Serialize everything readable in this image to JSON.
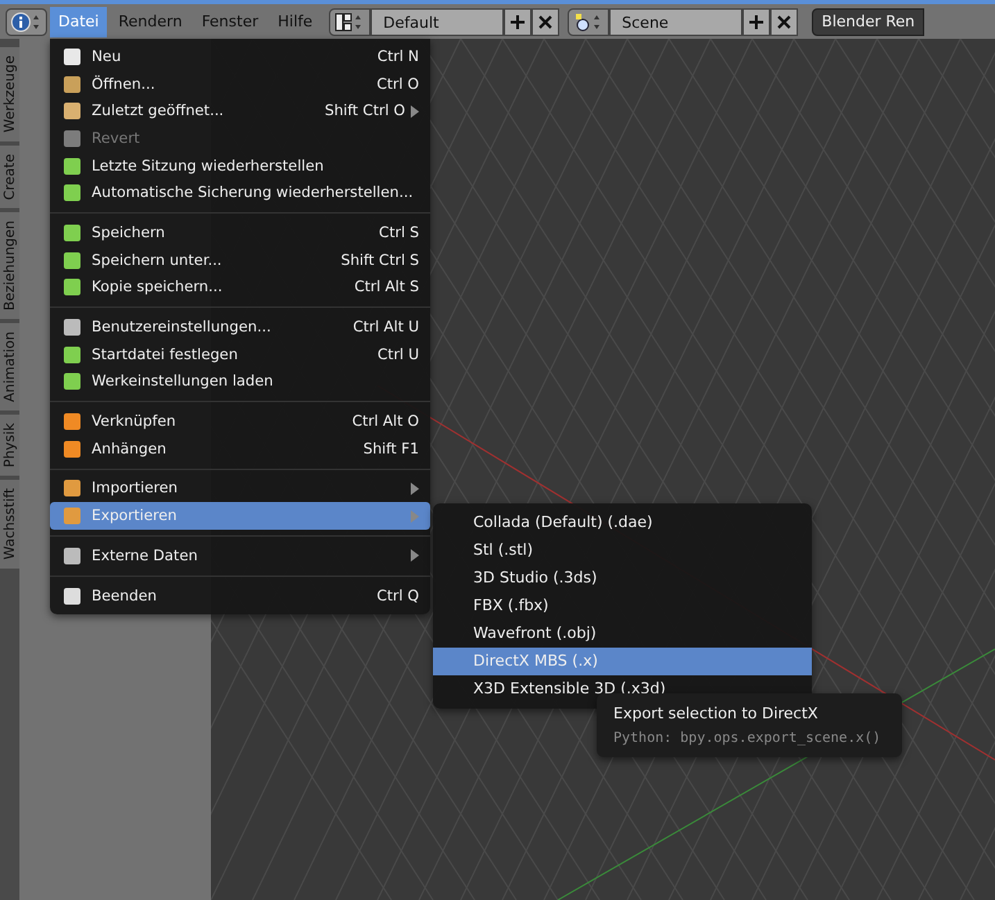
{
  "header": {
    "menus": [
      {
        "label": "Datei",
        "selected": true
      },
      {
        "label": "Rendern",
        "selected": false
      },
      {
        "label": "Fenster",
        "selected": false
      },
      {
        "label": "Hilfe",
        "selected": false
      }
    ],
    "layout": {
      "value": "Default"
    },
    "scene": {
      "value": "Scene"
    },
    "engine": {
      "value": "Blender Ren"
    }
  },
  "tool_tabs": [
    {
      "label": "Werkzeuge"
    },
    {
      "label": "Create"
    },
    {
      "label": "Beziehungen"
    },
    {
      "label": "Animation"
    },
    {
      "label": "Physik"
    },
    {
      "label": "Wachsstift"
    }
  ],
  "file_menu": {
    "items": [
      {
        "kind": "item",
        "label": "Neu",
        "shortcut": "Ctrl N",
        "disabled": false,
        "selected": false,
        "submenu": false
      },
      {
        "kind": "item",
        "label": "Öffnen...",
        "shortcut": "Ctrl O",
        "disabled": false,
        "selected": false,
        "submenu": false
      },
      {
        "kind": "item",
        "label": "Zuletzt geöffnet...",
        "shortcut": "Shift Ctrl O",
        "disabled": false,
        "selected": false,
        "submenu": true
      },
      {
        "kind": "item",
        "label": "Revert",
        "disabled": true,
        "selected": false,
        "submenu": false
      },
      {
        "kind": "item",
        "label": "Letzte Sitzung wiederherstellen",
        "disabled": false,
        "selected": false,
        "submenu": false
      },
      {
        "kind": "item",
        "label": "Automatische Sicherung wiederherstellen...",
        "disabled": false,
        "selected": false,
        "submenu": false
      },
      {
        "kind": "separator"
      },
      {
        "kind": "item",
        "label": "Speichern",
        "shortcut": "Ctrl S",
        "disabled": false,
        "selected": false,
        "submenu": false
      },
      {
        "kind": "item",
        "label": "Speichern unter...",
        "shortcut": "Shift Ctrl S",
        "disabled": false,
        "selected": false,
        "submenu": false
      },
      {
        "kind": "item",
        "label": "Kopie speichern...",
        "shortcut": "Ctrl Alt S",
        "disabled": false,
        "selected": false,
        "submenu": false
      },
      {
        "kind": "separator"
      },
      {
        "kind": "item",
        "label": "Benutzereinstellungen...",
        "shortcut": "Ctrl Alt U",
        "disabled": false,
        "selected": false,
        "submenu": false
      },
      {
        "kind": "item",
        "label": "Startdatei festlegen",
        "shortcut": "Ctrl U",
        "disabled": false,
        "selected": false,
        "submenu": false
      },
      {
        "kind": "item",
        "label": "Werkeinstellungen laden",
        "disabled": false,
        "selected": false,
        "submenu": false
      },
      {
        "kind": "separator"
      },
      {
        "kind": "item",
        "label": "Verknüpfen",
        "shortcut": "Ctrl Alt O",
        "disabled": false,
        "selected": false,
        "submenu": false
      },
      {
        "kind": "item",
        "label": "Anhängen",
        "shortcut": "Shift F1",
        "disabled": false,
        "selected": false,
        "submenu": false
      },
      {
        "kind": "separator"
      },
      {
        "kind": "item",
        "label": "Importieren",
        "disabled": false,
        "selected": false,
        "submenu": true
      },
      {
        "kind": "item",
        "label": "Exportieren",
        "disabled": false,
        "selected": true,
        "submenu": true
      },
      {
        "kind": "separator"
      },
      {
        "kind": "item",
        "label": "Externe Daten",
        "disabled": false,
        "selected": false,
        "submenu": true
      },
      {
        "kind": "separator"
      },
      {
        "kind": "item",
        "label": "Beenden",
        "shortcut": "Ctrl Q",
        "disabled": false,
        "selected": false,
        "submenu": false
      }
    ]
  },
  "export_menu": {
    "items": [
      {
        "label": "Collada (Default) (.dae)",
        "selected": false
      },
      {
        "label": "Stl (.stl)",
        "selected": false
      },
      {
        "label": "3D Studio (.3ds)",
        "selected": false
      },
      {
        "label": "FBX (.fbx)",
        "selected": false
      },
      {
        "label": "Wavefront (.obj)",
        "selected": false
      },
      {
        "label": "DirectX MBS (.x)",
        "selected": true
      },
      {
        "label": "X3D Extensible 3D (.x3d)",
        "selected": false
      }
    ]
  },
  "tooltip": {
    "title": "Export selection to DirectX",
    "python": "Python: bpy.ops.export_scene.x()"
  }
}
